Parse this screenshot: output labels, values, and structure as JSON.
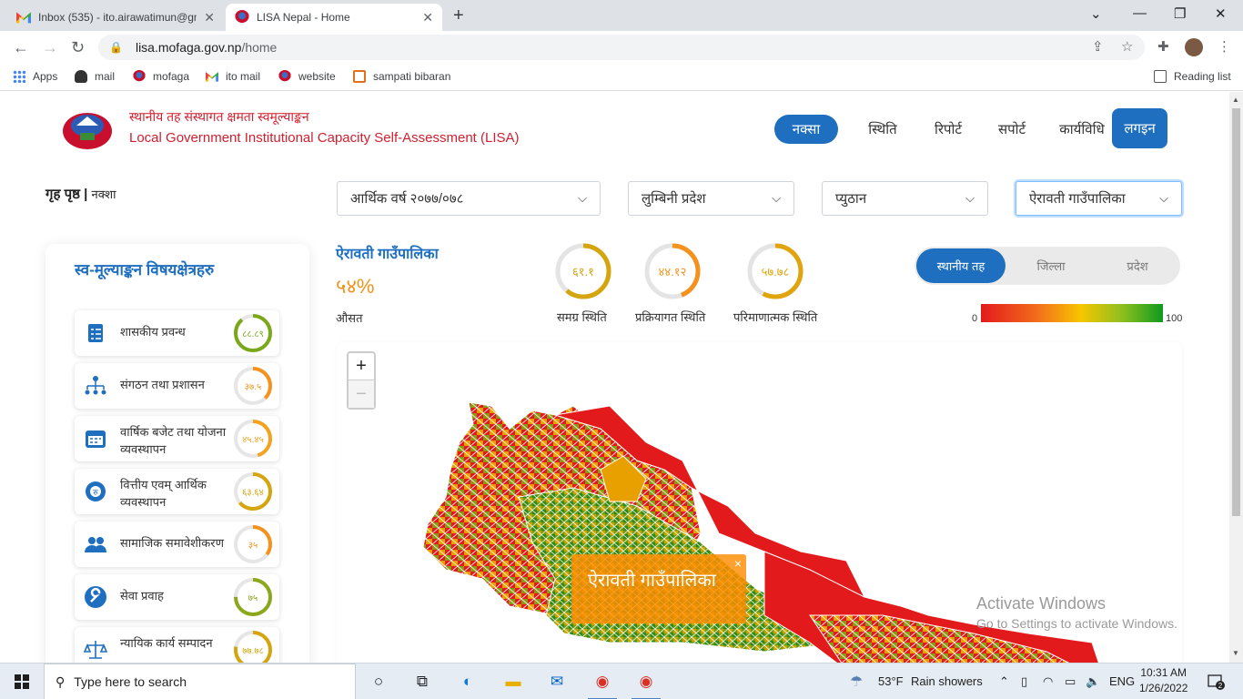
{
  "browser": {
    "tabs": [
      {
        "title": "Inbox (535) - ito.airawatimun@gm",
        "active": false
      },
      {
        "title": "LISA Nepal - Home",
        "active": true
      }
    ],
    "url_host": "lisa.mofaga.gov.np",
    "url_path": "/home",
    "bookmarks": [
      "Apps",
      "mail",
      "mofaga",
      "ito mail",
      "website",
      "sampati bibaran"
    ],
    "reading_list": "Reading list"
  },
  "site": {
    "title_np": "स्थानीय तह संस्थागत क्षमता स्वमूल्याङ्कन",
    "title_en": "Local Government Institutional Capacity Self-Assessment (LISA)",
    "nav": [
      "नक्सा",
      "स्थिति",
      "रिपोर्ट",
      "सपोर्ट",
      "कार्यविधि",
      "लगइन"
    ],
    "breadcrumb_home": "गृह पृष्ठ",
    "breadcrumb_sep": "|",
    "breadcrumb_current": "नक्शा"
  },
  "filters": {
    "fiscal_year": "आर्थिक वर्ष २०७७/०७८",
    "province": "लुम्बिनी प्रदेश",
    "district": "प्युठान",
    "municipality": "ऐरावती गाउँपालिका"
  },
  "panel": {
    "title": "स्व-मूल्याङ्कन विषयक्षेत्रहरु",
    "items": [
      {
        "label": "शासकीय प्रवन्ध",
        "value": "८८.८९",
        "score": 88.89,
        "color": "#7aa81a",
        "icon": "checklist-icon"
      },
      {
        "label": "संगठन तथा प्रशासन",
        "value": "३७.५",
        "score": 37.5,
        "color": "#f5921e",
        "icon": "org-chart-icon"
      },
      {
        "label": "वार्षिक बजेट तथा योजना व्यवस्थापन",
        "value": "४५.४५",
        "score": 45.45,
        "color": "#f5a21e",
        "icon": "calendar-icon"
      },
      {
        "label": "वित्तीय एवम् आर्थिक व्यवस्थापन",
        "value": "६३.६४",
        "score": 63.64,
        "color": "#d4a50f",
        "icon": "finance-gear-icon"
      },
      {
        "label": "सामाजिक समावेशीकरण",
        "value": "३५",
        "score": 35,
        "color": "#f5921e",
        "icon": "people-icon"
      },
      {
        "label": "सेवा प्रवाह",
        "value": "७५",
        "score": 75,
        "color": "#8aa81a",
        "icon": "wrench-icon"
      },
      {
        "label": "न्यायिक कार्य सम्पादन",
        "value": "७७.७८",
        "score": 77.78,
        "color": "#d4a50f",
        "icon": "scales-icon"
      }
    ]
  },
  "summary": {
    "name": "ऐरावती गाउँपालिका",
    "percent": "५४%",
    "percent_label": "औसत",
    "gauges": [
      {
        "value": "६१.१",
        "score": 61.1,
        "label": "समग्र स्थिति",
        "color": "#d4a50f"
      },
      {
        "value": "४४.१२",
        "score": 44.12,
        "label": "प्रक्रियागत स्थिति",
        "color": "#f5921e"
      },
      {
        "value": "५७.७८",
        "score": 57.78,
        "label": "परिमाणात्मक स्थिति",
        "color": "#e0a40c"
      }
    ]
  },
  "level_toggle": {
    "options": [
      "स्थानीय तह",
      "जिल्ला",
      "प्रदेश"
    ],
    "selected": "स्थानीय तह"
  },
  "legend": {
    "min": "0",
    "max": "100"
  },
  "map": {
    "zoom_in": "+",
    "zoom_out": "−",
    "popup_title": "ऐरावती गाउँपालिका",
    "popup_close": "×"
  },
  "watermark": {
    "line1": "Activate Windows",
    "line2": "Go to Settings to activate Windows."
  },
  "taskbar": {
    "search_placeholder": "Type here to search",
    "weather_temp": "53°F",
    "weather_text": "Rain showers",
    "lang": "ENG",
    "time": "10:31 AM",
    "date": "1/26/2022",
    "notifications": "2"
  }
}
